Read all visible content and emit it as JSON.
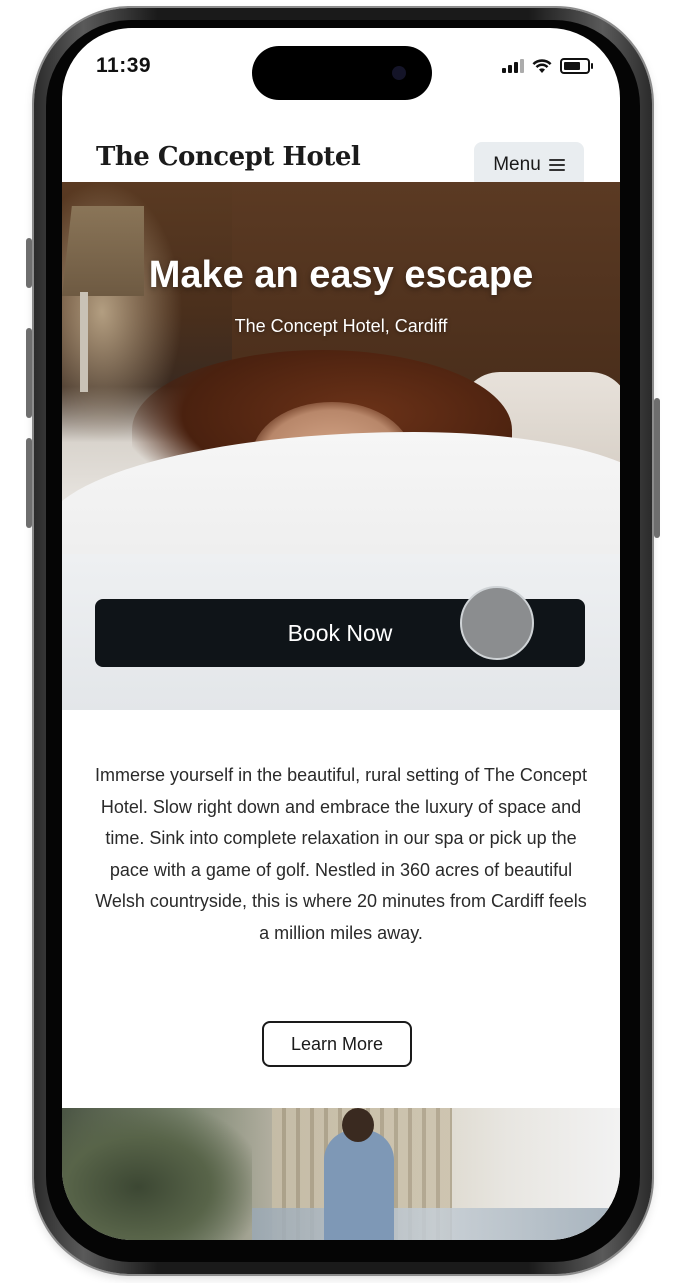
{
  "status_bar": {
    "time": "11:39"
  },
  "header": {
    "brand": "The Concept Hotel",
    "menu_label": "Menu"
  },
  "hero": {
    "title": "Make an easy escape",
    "subtitle": "The Concept Hotel, Cardiff"
  },
  "booking": {
    "button_label": "Book Now"
  },
  "intro": {
    "text": "Immerse yourself in the beautiful, rural setting of The Concept Hotel. Slow right down and embrace the luxury of space and time. Sink into complete relaxation in our spa or pick up the pace with a game of golf. Nestled in 360 acres of beautiful Welsh countryside, this is where 20 minutes from Cardiff feels a million miles away.",
    "button_label": "Learn More"
  },
  "icons": {
    "menu": "hamburger-icon",
    "signal": "cellular-signal-icon",
    "wifi": "wifi-icon",
    "battery": "battery-icon"
  },
  "colors": {
    "primary_button": "#0f1418",
    "menu_button_bg": "#e9edf0",
    "text": "#2a2a2a"
  }
}
